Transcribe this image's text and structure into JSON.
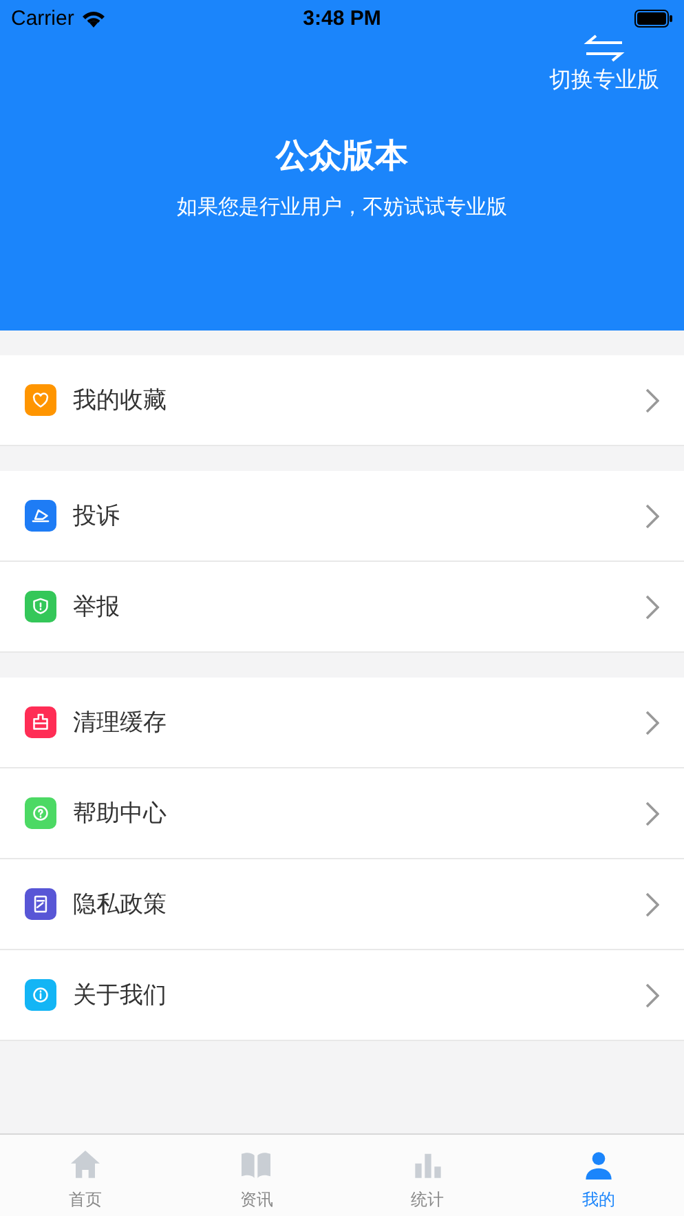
{
  "status_bar": {
    "carrier": "Carrier",
    "time": "3:48 PM"
  },
  "header": {
    "switch_label": "切换专业版",
    "title": "公众版本",
    "subtitle": "如果您是行业用户，不妨试试专业版"
  },
  "groups": [
    {
      "items": [
        {
          "label": "我的收藏",
          "color": "#ff9500"
        }
      ]
    },
    {
      "items": [
        {
          "label": "投诉",
          "color": "#1e7cf5"
        },
        {
          "label": "举报",
          "color": "#34c759"
        }
      ]
    },
    {
      "items": [
        {
          "label": "清理缓存",
          "color": "#ff2d55"
        },
        {
          "label": "帮助中心",
          "color": "#4cd964"
        },
        {
          "label": "隐私政策",
          "color": "#5856d6"
        },
        {
          "label": "关于我们",
          "color": "#13b5f5"
        }
      ]
    }
  ],
  "tabs": [
    {
      "label": "首页",
      "selected": false
    },
    {
      "label": "资讯",
      "selected": false
    },
    {
      "label": "统计",
      "selected": false
    },
    {
      "label": "我的",
      "selected": true
    }
  ]
}
